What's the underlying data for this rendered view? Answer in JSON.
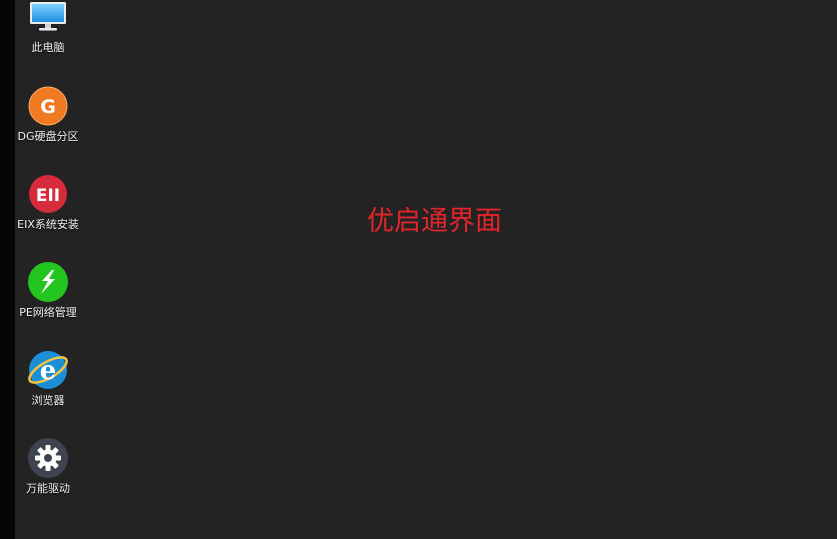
{
  "desktop": {
    "icons": [
      {
        "label": "此电脑",
        "icon": "computer-monitor-icon"
      },
      {
        "label": "DG硬盘分区",
        "icon": "diskgenius-icon"
      },
      {
        "label": "EIX系统安装",
        "icon": "eix-install-icon"
      },
      {
        "label": "PE网络管理",
        "icon": "network-manager-icon"
      },
      {
        "label": "浏览器",
        "icon": "ie-browser-icon"
      },
      {
        "label": "万能驱动",
        "icon": "gear-icon"
      }
    ],
    "center_text": "优启通界面",
    "icon_glyphs": {
      "diskgenius": "G",
      "eix": "EII",
      "browser": "e"
    }
  },
  "colors": {
    "background": "#232323",
    "center_text": "#e3242b",
    "diskgenius": "#f07a22",
    "eix": "#d52b3b",
    "network": "#22c61f",
    "browser": "#1d8fd6",
    "gear": "#3d4450"
  }
}
